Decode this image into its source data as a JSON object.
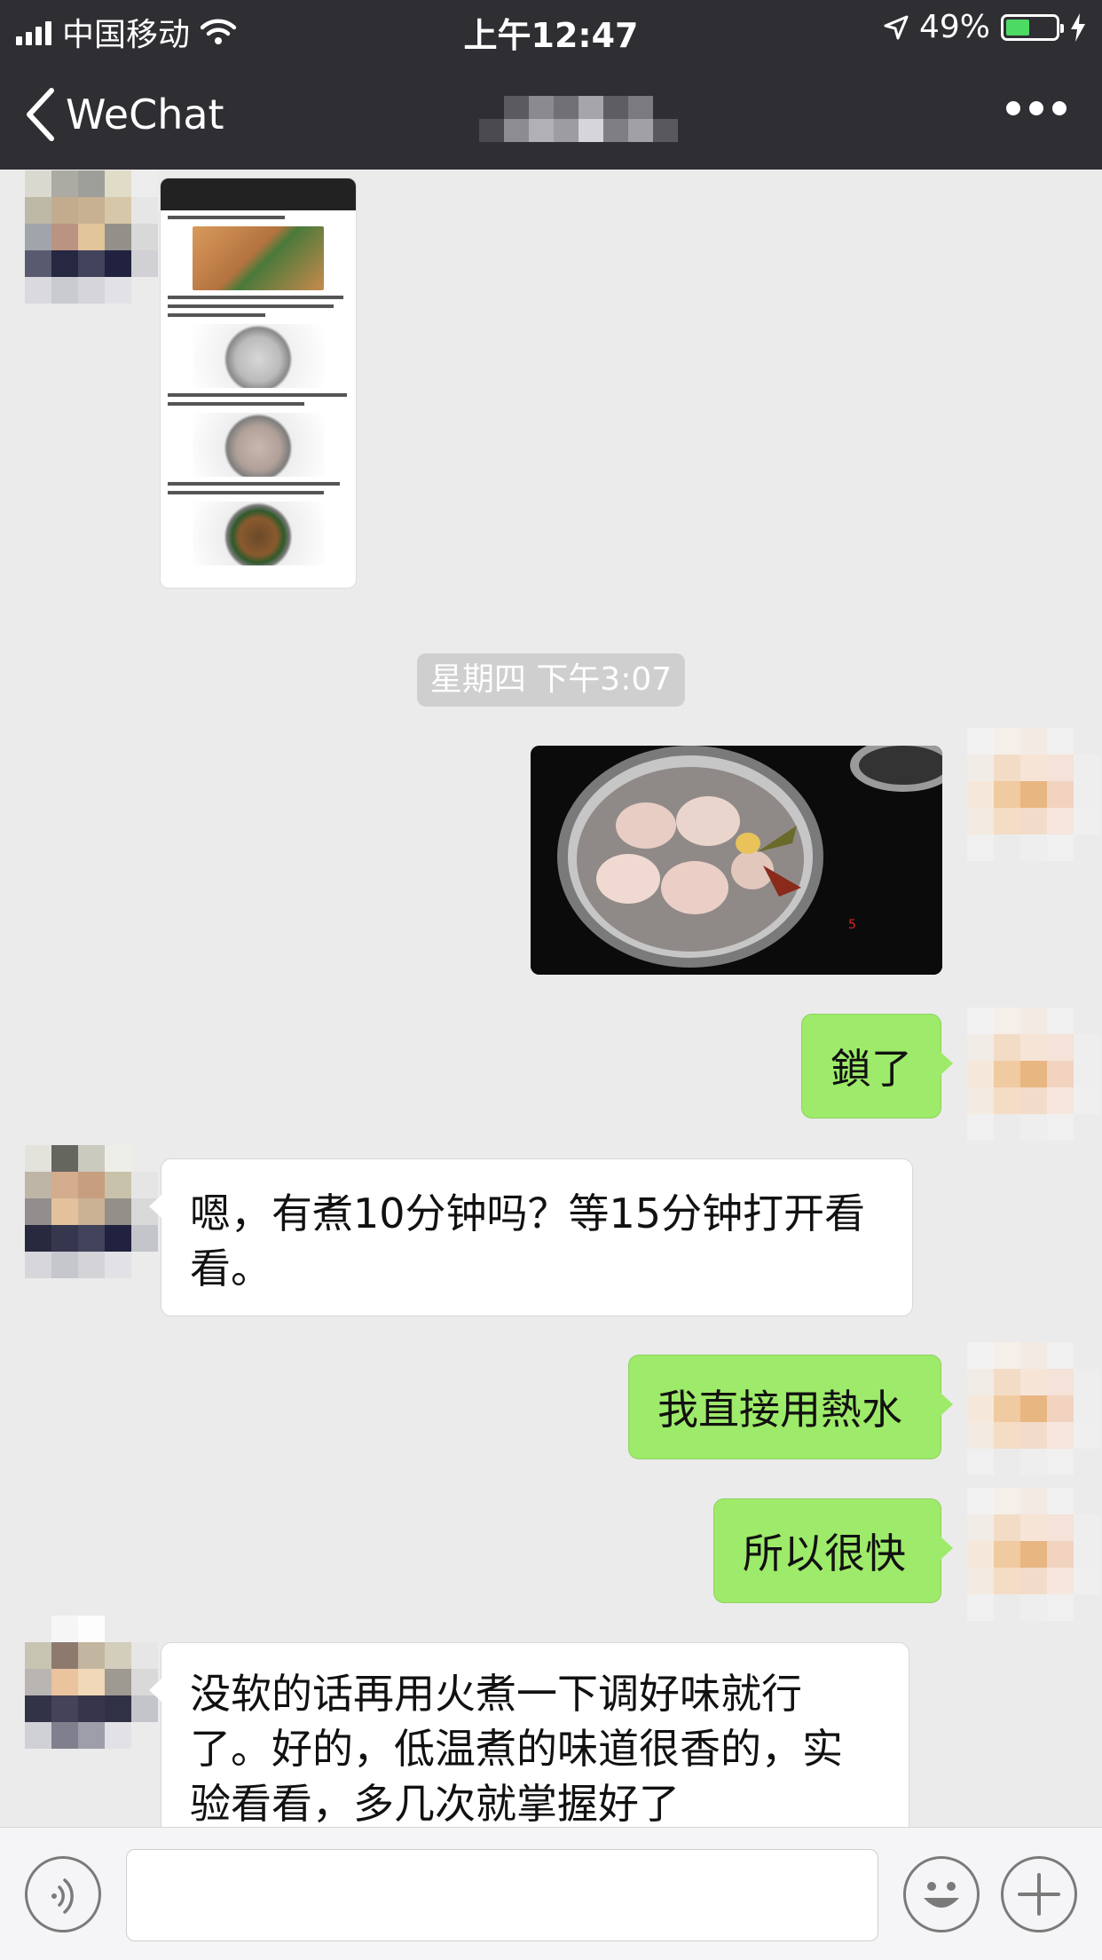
{
  "status_bar": {
    "carrier": "中国移动",
    "time": "上午12:47",
    "battery": "49%",
    "battery_level": 0.49,
    "icons": [
      "signal-icon",
      "wifi-icon",
      "location-icon",
      "battery-icon",
      "charging-icon"
    ]
  },
  "nav": {
    "back_label": "WeChat",
    "more_icon": "more-icon"
  },
  "chat": {
    "timestamp": "星期四 下午3:07",
    "messages": [
      {
        "from": "contact",
        "type": "image",
        "image": "recipe-screenshot"
      },
      {
        "from": "me",
        "type": "image",
        "image": "pot-photo"
      },
      {
        "from": "me",
        "type": "text",
        "text": "鎖了"
      },
      {
        "from": "contact",
        "type": "text",
        "text": "嗯，有煮10分钟吗？等15分钟打开看看。"
      },
      {
        "from": "me",
        "type": "text",
        "text": "我直接用熱水"
      },
      {
        "from": "me",
        "type": "text",
        "text": "所以很快"
      },
      {
        "from": "contact",
        "type": "text",
        "text": "没软的话再用火煮一下调好味就行了。好的，低温煮的味道很香的，实验看看，多几次就掌握好了"
      }
    ]
  },
  "input_bar": {
    "value": "",
    "voice_icon": "voice-icon",
    "emoji_icon": "emoji-icon",
    "add_icon": "add-icon"
  },
  "colors": {
    "nav_background": "#2e2e33",
    "chat_background": "#ebebeb",
    "outgoing_bubble": "#9eea6a",
    "incoming_bubble": "#ffffff",
    "battery_fill": "#4cd964"
  }
}
